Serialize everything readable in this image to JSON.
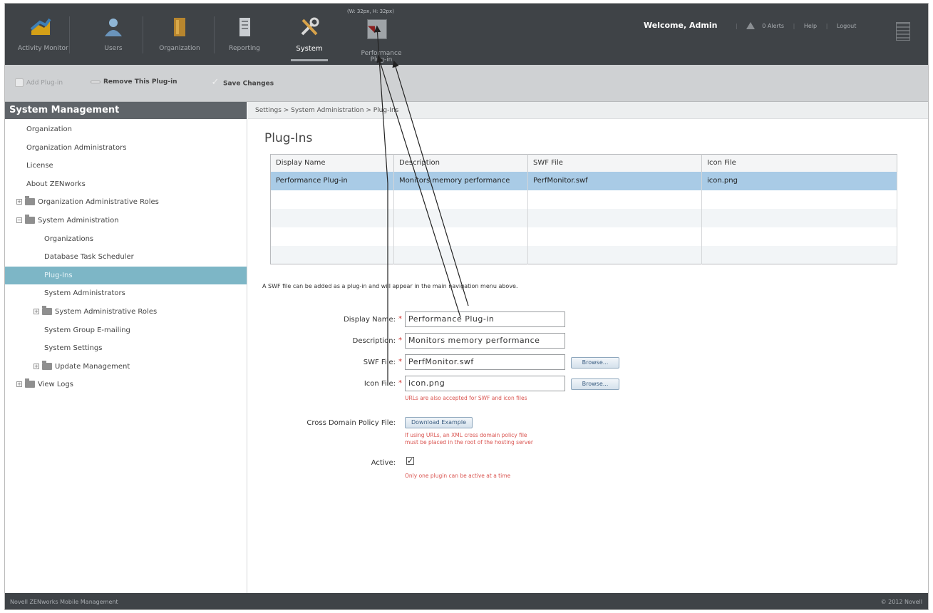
{
  "nav": {
    "items": [
      {
        "label": "Activity Monitor",
        "icon": "activity-monitor-icon"
      },
      {
        "label": "Users",
        "icon": "users-icon"
      },
      {
        "label": "Organization",
        "icon": "organization-icon"
      },
      {
        "label": "Reporting",
        "icon": "reporting-icon"
      },
      {
        "label": "System",
        "icon": "system-tools-icon"
      },
      {
        "label": "Performance Plug-in",
        "icon": "performance-plugin-icon"
      }
    ],
    "dims_label": "(W: 32px, H: 32px)",
    "welcome": "Welcome, Admin",
    "alerts": "0 Alerts",
    "help": "Help",
    "logout": "Logout"
  },
  "toolbar": {
    "add": "Add Plug-in",
    "remove": "Remove This Plug-in",
    "save": "Save Changes"
  },
  "sidebar": {
    "title": "System Management",
    "items": [
      "Organization",
      "Organization Administrators",
      "License",
      "About ZENworks",
      "Organization Administrative Roles",
      "System Administration",
      "Organizations",
      "Database Task Scheduler",
      "Plug-Ins",
      "System Administrators",
      "System Administrative Roles",
      "System Group E-mailing",
      "System Settings",
      "Update Management",
      "View Logs"
    ]
  },
  "breadcrumb": "Settings > System Administration > Plug-Ins",
  "page_title": "Plug-Ins",
  "table": {
    "columns": [
      "Display Name",
      "Description",
      "SWF File",
      "Icon File"
    ],
    "rows": [
      [
        "Performance Plug-in",
        "Monitors memory performance",
        "PerfMonitor.swf",
        "icon.png"
      ]
    ]
  },
  "info_text": "A SWF file can be added as a plug-in and will appear in the main navigation menu above.",
  "form": {
    "display_name_label": "Display Name:",
    "display_name_value": "Performance Plug-in",
    "description_label": "Description:",
    "description_value": "Monitors memory performance",
    "swf_label": "SWF File:",
    "swf_value": "PerfMonitor.swf",
    "icon_label": "Icon File:",
    "icon_value": "icon.png",
    "browse": "Browse...",
    "urls_note": "URLs are also accepted for SWF and icon files",
    "cross_domain_label": "Cross Domain Policy File:",
    "download_example": "Download Example",
    "cross_domain_note_1": "If using URLs, an XML cross domain policy file",
    "cross_domain_note_2": "must be placed in the root of the hosting server",
    "active_label": "Active:",
    "active_checked": true,
    "active_note": "Only one plugin can be active at a time",
    "required_mark": "*"
  },
  "footer": {
    "left": "Novell ZENworks Mobile Management",
    "right": "© 2012 Novell"
  }
}
